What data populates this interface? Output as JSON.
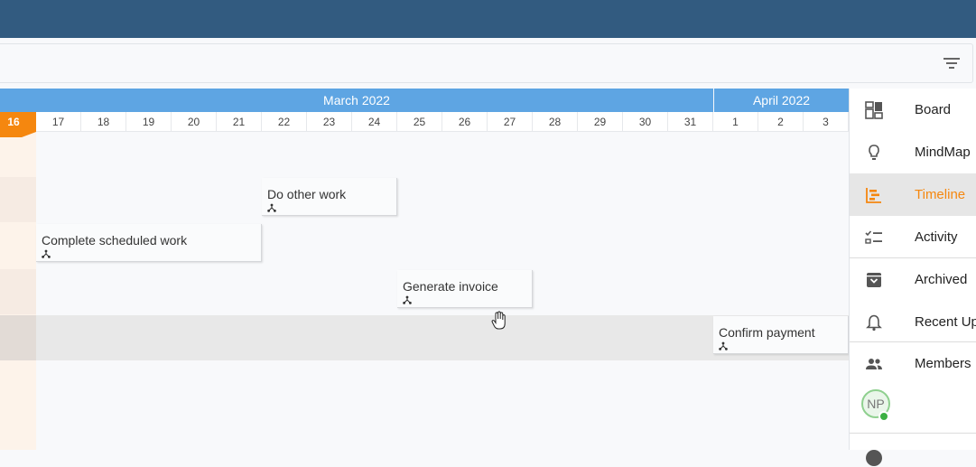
{
  "timeline": {
    "months": [
      {
        "label": "March 2022"
      },
      {
        "label": "April 2022"
      }
    ],
    "days": [
      "16",
      "17",
      "18",
      "19",
      "20",
      "21",
      "22",
      "23",
      "24",
      "25",
      "26",
      "27",
      "28",
      "29",
      "30",
      "31",
      "1",
      "2",
      "3"
    ],
    "today": "16",
    "tasks": [
      {
        "label": "Do other work"
      },
      {
        "label": "Complete scheduled work"
      },
      {
        "label": "Generate invoice"
      },
      {
        "label": "Confirm payment"
      }
    ]
  },
  "sidebar": {
    "items": [
      {
        "label": "Board",
        "icon": "board-icon"
      },
      {
        "label": "MindMap",
        "icon": "lightbulb-icon"
      },
      {
        "label": "Timeline",
        "icon": "timeline-icon",
        "active": true
      },
      {
        "label": "Activity",
        "icon": "checklist-icon"
      },
      {
        "label": "Archived",
        "icon": "archive-icon"
      },
      {
        "label": "Recent Up",
        "icon": "bell-icon"
      },
      {
        "label": "Members",
        "icon": "people-icon"
      }
    ],
    "member_initials": "NP"
  },
  "colors": {
    "topbar": "#325b80",
    "month_header": "#5ea5e3",
    "accent": "#f5870f",
    "online": "#3cb043"
  }
}
